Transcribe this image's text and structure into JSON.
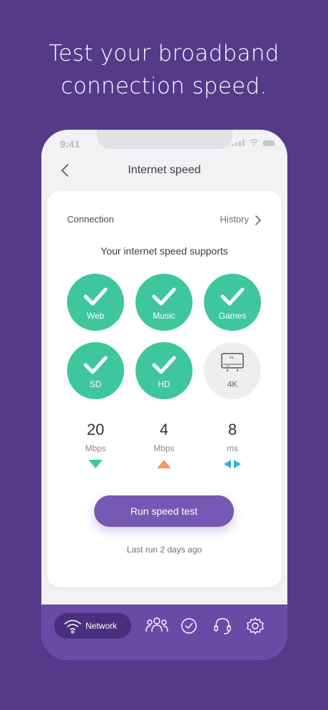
{
  "headline": {
    "line1": "Test your broadband",
    "line2": "connection speed."
  },
  "status_bar": {
    "time": "9:41"
  },
  "nav": {
    "title": "Internet speed",
    "back_icon": "chevron-left-icon"
  },
  "card": {
    "connection_label": "Connection",
    "history_label": "History",
    "supports_heading": "Your internet speed supports",
    "capabilities": [
      {
        "label": "Web",
        "supported": true
      },
      {
        "label": "Music",
        "supported": true
      },
      {
        "label": "Games",
        "supported": true
      },
      {
        "label": "SD",
        "supported": true
      },
      {
        "label": "HD",
        "supported": true
      },
      {
        "label": "4K",
        "supported": false
      }
    ],
    "metrics": [
      {
        "value": "20",
        "unit": "Mbps",
        "icon": "download-arrow-icon",
        "color": "#3ec79c"
      },
      {
        "value": "4",
        "unit": "Mbps",
        "icon": "upload-arrow-icon",
        "color": "#f49a5a"
      },
      {
        "value": "8",
        "unit": "ms",
        "icon": "ping-arrows-icon",
        "color": "#2bb6d9"
      }
    ],
    "run_button": "Run speed test",
    "last_run": "Last run 2 days ago"
  },
  "tabbar": {
    "active_label": "Network",
    "tabs": [
      "wifi-icon",
      "people-icon",
      "clock-icon",
      "headset-icon",
      "gear-icon"
    ]
  },
  "colors": {
    "background": "#563a8a",
    "accent_green": "#3ec79c",
    "button_purple": "#7558b3",
    "tabbar": "#6b4aa6"
  }
}
